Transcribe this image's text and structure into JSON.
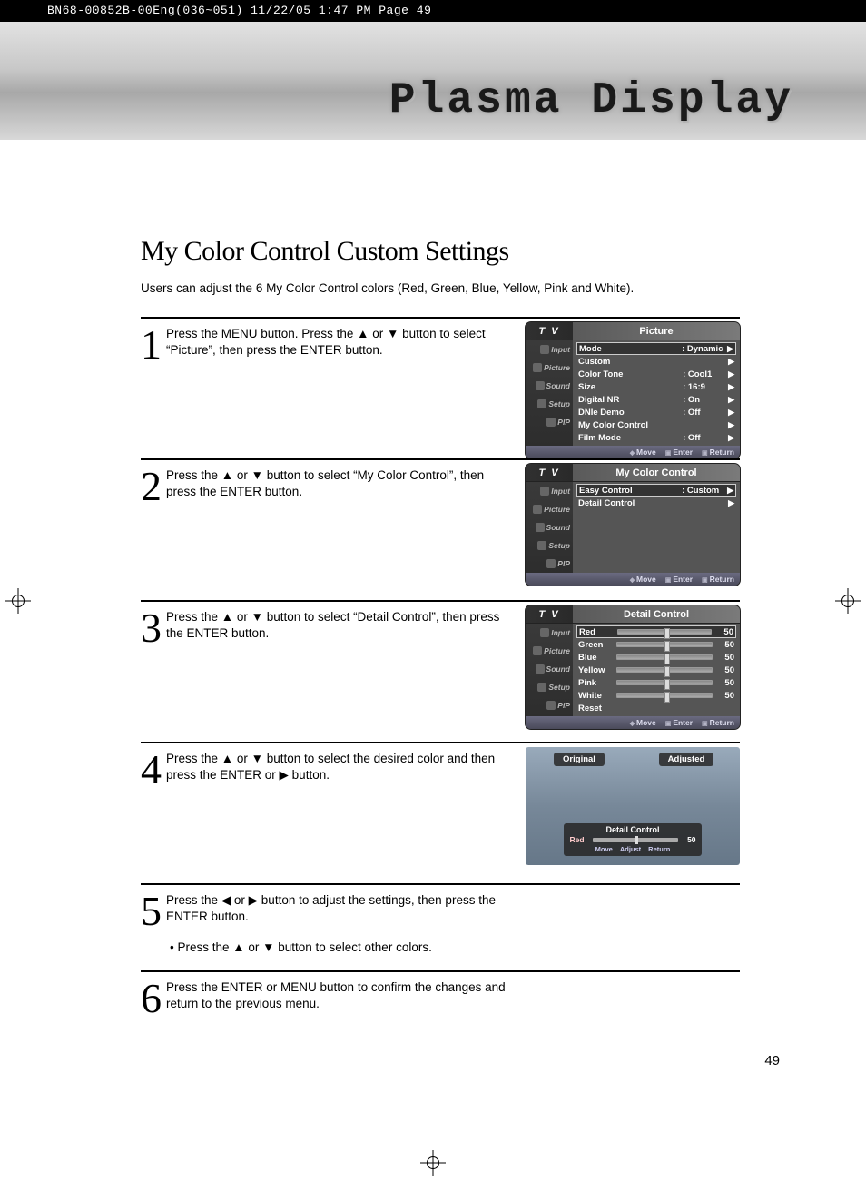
{
  "crop_line": "BN68-00852B-00Eng(036~051)  11/22/05  1:47 PM  Page 49",
  "header": "Plasma Display",
  "title": "My Color Control Custom Settings",
  "intro": "Users can adjust the 6 My Color Control colors (Red, Green, Blue, Yellow, Pink and White).",
  "steps": {
    "s1": "Press the MENU button. Press the ▲ or ▼ button to select “Picture”, then press the ENTER button.",
    "s2": "Press the ▲ or ▼ button to select “My Color Control”, then press the ENTER button.",
    "s3": "Press the ▲ or ▼ button to select “Detail Control”, then press the ENTER button.",
    "s4": "Press the ▲ or ▼ button to select the desired color and then press the ENTER or ▶ button.",
    "s5": "Press the ◀ or ▶ button to adjust the settings, then press the ENTER button.",
    "s5b": "• Press the ▲ or ▼ button to select other colors.",
    "s6": "Press the ENTER or MENU button to confirm the changes and return to the previous menu."
  },
  "nums": {
    "n1": "1",
    "n2": "2",
    "n3": "3",
    "n4": "4",
    "n5": "5",
    "n6": "6"
  },
  "page": "49",
  "osd": {
    "tv": "T V",
    "side": {
      "input": "Input",
      "picture": "Picture",
      "sound": "Sound",
      "setup": "Setup",
      "pip": "PIP"
    },
    "foot": {
      "move": "Move",
      "enter": "Enter",
      "ret": "Return",
      "adjust": "Adjust"
    }
  },
  "osd1": {
    "title": "Picture",
    "rows": {
      "mode_l": "Mode",
      "mode_v": ": Dynamic",
      "custom": "Custom",
      "tone_l": "Color Tone",
      "tone_v": ": Cool1",
      "size_l": "Size",
      "size_v": ": 16:9",
      "nr_l": "Digital NR",
      "nr_v": ": On",
      "dnie_l": "DNIe Demo",
      "dnie_v": ": Off",
      "mcc": "My Color Control",
      "film_l": "Film Mode",
      "film_v": ": Off"
    }
  },
  "osd2": {
    "title": "My Color Control",
    "rows": {
      "easy_l": "Easy Control",
      "easy_v": ": Custom",
      "detail": "Detail Control"
    }
  },
  "osd3": {
    "title": "Detail Control",
    "rows": {
      "red": "Red",
      "green": "Green",
      "blue": "Blue",
      "yellow": "Yellow",
      "pink": "Pink",
      "white": "White",
      "reset": "Reset"
    },
    "val": "50"
  },
  "preview": {
    "orig": "Original",
    "adj": "Adjusted",
    "panel_title": "Detail Control",
    "red": "Red",
    "val": "50"
  }
}
